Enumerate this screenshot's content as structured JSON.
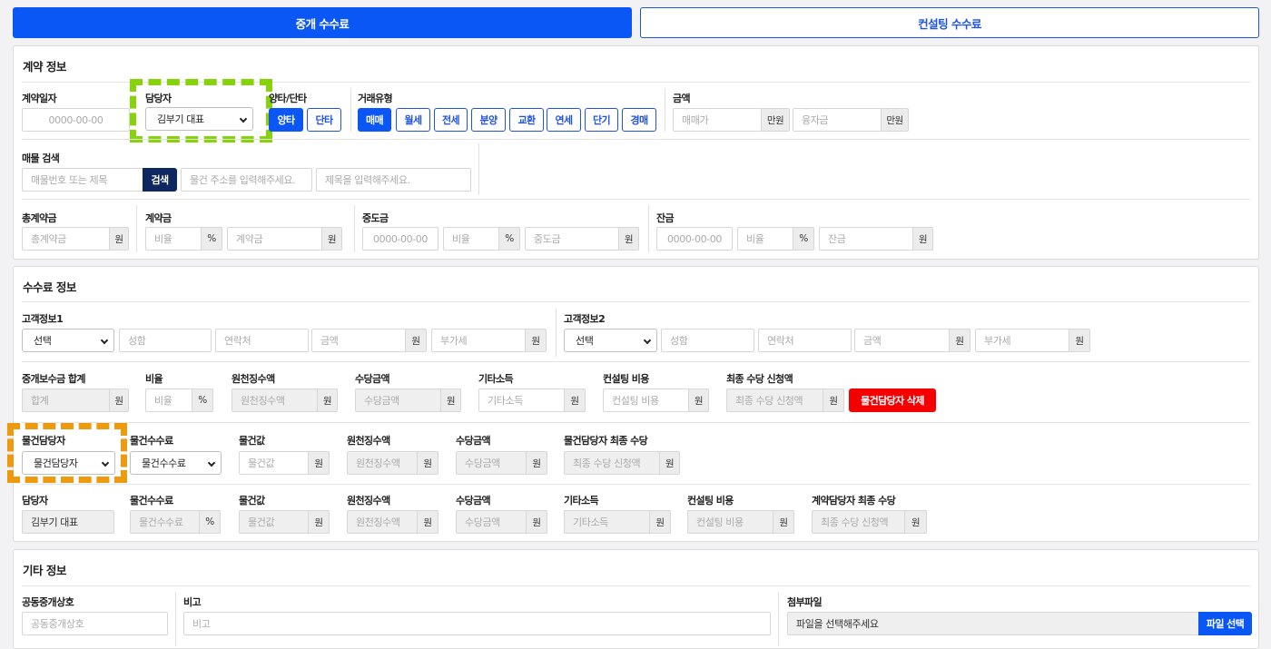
{
  "tabs": {
    "brokerage": "중개 수수료",
    "consulting": "컨설팅 수수료"
  },
  "contract": {
    "title": "계약 정보",
    "date_label": "계약일자",
    "date_placeholder": "0000-00-00",
    "manager_label": "담당자",
    "manager_value": "김부기 대표",
    "side_label": "양타/단타",
    "side_both": "양타",
    "side_single": "단타",
    "deal_type_label": "거래유형",
    "deal_types": [
      "매매",
      "월세",
      "전세",
      "분양",
      "교환",
      "연세",
      "단기",
      "경매"
    ],
    "amount_label": "금액",
    "sale_price_ph": "매매가",
    "loan_ph": "융자금",
    "unit_manwon": "만원",
    "search_label": "매물 검색",
    "search_ph": "매물번호 또는 제목",
    "search_btn": "검색",
    "address_ph": "물건 주소를 입력해주세요.",
    "title_ph": "제목을 입력해주세요.",
    "total_label": "총계약금",
    "total_ph": "총계약금",
    "won": "원",
    "percent": "%",
    "deposit_label": "계약금",
    "ratio_ph": "비율",
    "deposit_ph": "계약금",
    "middle_label": "중도금",
    "middle_date_ph": "0000-00-00",
    "middle_ph": "중도금",
    "balance_label": "잔금",
    "balance_date_ph": "0000-00-00",
    "balance_ph": "잔금"
  },
  "fee": {
    "title": "수수료 정보",
    "customer1_label": "고객정보1",
    "customer2_label": "고객정보2",
    "select_value": "선택",
    "name_ph": "성함",
    "contact_ph": "연락처",
    "amount_ph": "금액",
    "vat_ph": "부가세",
    "total_label": "중개보수금 합계",
    "total_ph": "합계",
    "ratio_label": "비율",
    "ratio_ph": "비율",
    "withholding_label": "원천징수액",
    "withholding_ph": "원천징수액",
    "allowance_label": "수당금액",
    "allowance_ph": "수당금액",
    "other_income_label": "기타소득",
    "other_income_ph": "기타소득",
    "consult_label": "컨설팅 비용",
    "consult_ph": "컨설팅 비용",
    "final_label": "최종 수당 신청액",
    "final_ph": "최종 수당 신청액",
    "delete_btn": "물건담당자 삭제",
    "prop_manager_label": "물건담당자",
    "prop_manager_value": "물건담당자",
    "prop_fee_label": "물건수수료",
    "prop_fee_value": "물건수수료",
    "prop_price_label": "물건값",
    "prop_price_ph": "물건값",
    "prop_final_label": "물건담당자 최종 수당",
    "manager_label": "담당자",
    "manager_value": "김부기 대표",
    "contract_final_label": "계약담당자 최종 수당"
  },
  "etc": {
    "title": "기타 정보",
    "co_broker_label": "공동중개상호",
    "co_broker_ph": "공동중개상호",
    "memo_label": "비고",
    "memo_ph": "비고",
    "file_label": "첨부파일",
    "file_ph": "파일을 선택해주세요",
    "file_btn": "파일 선택"
  },
  "colors": {
    "primary": "#0b57f5",
    "navy": "#0f2760",
    "danger": "#f40000",
    "highlight_green": "#86d30c",
    "highlight_orange": "#ee9a0e"
  }
}
